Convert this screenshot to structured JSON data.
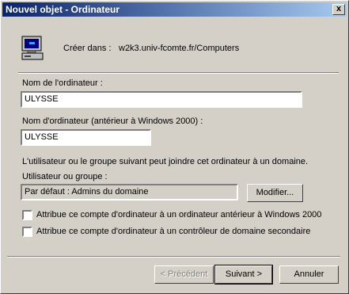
{
  "window": {
    "title": "Nouvel objet - Ordinateur",
    "close_glyph": "x"
  },
  "header": {
    "create_in_label": "Créer dans :",
    "create_in_value": "w2k3.univ-fcomte.fr/Computers",
    "icon": "computer-icon"
  },
  "form": {
    "computer_name_label": "Nom de l'ordinateur :",
    "computer_name_value": "ULYSSE",
    "netbios_name_label": "Nom d'ordinateur (antérieur à Windows 2000) :",
    "netbios_name_value": "ULYSSE",
    "join_info": "L'utilisateur ou le groupe suivant peut joindre cet ordinateur à un domaine.",
    "user_group_label": "Utilisateur ou groupe :",
    "user_group_value": "Par défaut : Admins du domaine",
    "modify_button": "Modifier...",
    "checkbox_pre2000": "Attribue ce compte d'ordinateur à un ordinateur antérieur à Windows 2000",
    "checkbox_bdc": "Attribue ce compte d'ordinateur à un contrôleur de domaine secondaire"
  },
  "footer": {
    "back_button": "< Précédent",
    "next_button": "Suivant >",
    "cancel_button": "Annuler"
  }
}
